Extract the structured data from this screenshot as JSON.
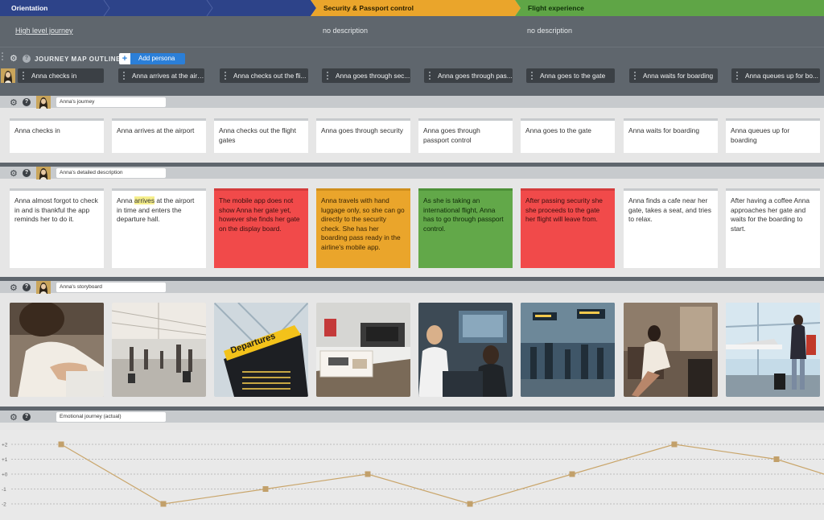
{
  "phases": [
    {
      "label": "Orientation",
      "color": "#2d4389",
      "text_color": "#ffffff"
    },
    {
      "label": "Security & Passport control",
      "color": "#eaa52b",
      "text_color": "#2b2000"
    },
    {
      "label": "Flight experience",
      "color": "#5fa546",
      "text_color": "#10300a"
    }
  ],
  "phase_descriptions": [
    "High level journey",
    "no description",
    "no description"
  ],
  "outline": {
    "title": "JOURNEY MAP OUTLINE",
    "add_persona": "Add persona",
    "steps": [
      "Anna checks in",
      "Anna arrives at the airp...",
      "Anna checks out the fli...",
      "Anna goes through sec...",
      "Anna goes through pas...",
      "Anna goes to the gate",
      "Anna waits for boarding",
      "Anna queues up for bo..."
    ]
  },
  "lanes": {
    "journey": "Anna's journey",
    "detailed": "Anna's detailed description",
    "storyboard": "Anna's storyboard",
    "emotion": "Emotional journey (actual)"
  },
  "journey_cards": [
    "Anna checks in",
    "Anna arrives at the airport",
    "Anna checks out the flight gates",
    "Anna goes through security",
    "Anna goes through passport control",
    "Anna goes to the gate",
    "Anna waits for boarding",
    "Anna queues up for boarding"
  ],
  "detail_cards": [
    {
      "text": "Anna almost forgot to check in and is thankful the app reminds her to do it.",
      "color": "white"
    },
    {
      "pre": "Anna ",
      "highlight": "arrives",
      "post": " at the airport in time and enters the departure hall.",
      "color": "white"
    },
    {
      "text": "The mobile app does not show Anna her gate yet, however she finds her gate on the display board.",
      "color": "red"
    },
    {
      "text": "Anna travels with hand luggage only, so she can go directly to the security check. She has her boarding pass ready in the airline's mobile app.",
      "color": "orange"
    },
    {
      "text": "As she is taking an international flight, Anna has to go through passport control.",
      "color": "green"
    },
    {
      "text": "After passing security she she proceeds to the gate her flight will leave from.",
      "color": "red"
    },
    {
      "text": "Anna finds a cafe near her gate, takes a seat, and tries to relax.",
      "color": "white"
    },
    {
      "text": "After having a coffee Anna approaches her gate and waits for the boarding to start.",
      "color": "white"
    }
  ],
  "storyboard": [
    {
      "icon": "hand-writing-photo",
      "sign": ""
    },
    {
      "icon": "airport-hall-photo",
      "sign": ""
    },
    {
      "icon": "departures-board-photo",
      "sign": "Departures"
    },
    {
      "icon": "security-tray-photo",
      "sign": ""
    },
    {
      "icon": "passport-control-photo",
      "sign": ""
    },
    {
      "icon": "terminal-crowd-photo",
      "sign": ""
    },
    {
      "icon": "cafe-woman-photo",
      "sign": ""
    },
    {
      "icon": "window-gate-photo",
      "sign": ""
    }
  ],
  "chart_data": {
    "type": "line",
    "categories": [
      "Anna checks in",
      "Anna arrives at the airport",
      "Anna checks out the flight gates",
      "Anna goes through security",
      "Anna goes through passport control",
      "Anna goes to the gate",
      "Anna waits for boarding",
      "Anna queues up for boarding"
    ],
    "values": [
      2,
      -2,
      -1,
      0,
      -2,
      0,
      2,
      1
    ],
    "y_ticks": [
      "+2",
      "+1",
      "+0",
      "-1",
      "-2"
    ],
    "ylim": [
      -2,
      2
    ],
    "line_color": "#c9a56a",
    "marker_color": "#c2a06a",
    "grid": true
  }
}
